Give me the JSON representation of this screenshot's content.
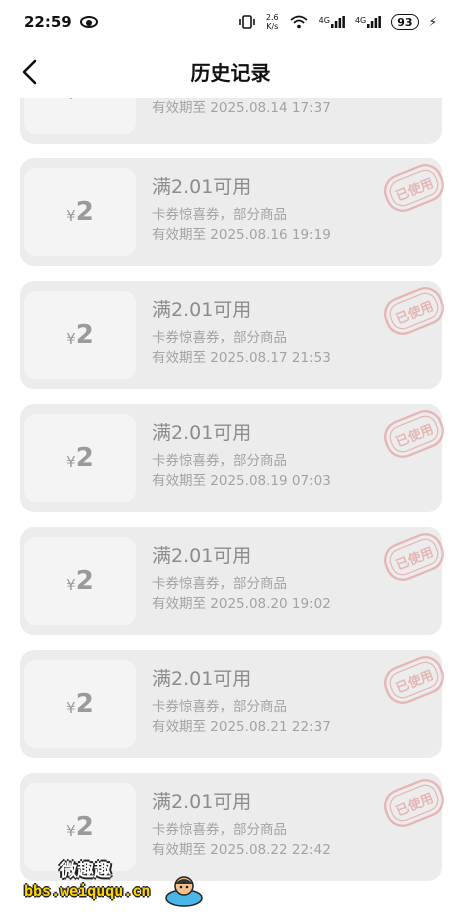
{
  "status_bar": {
    "time": "22:59",
    "net_speed_top": "2.6",
    "net_speed_unit": "K/s",
    "sig1": "4G",
    "sig2": "4G",
    "battery": "93"
  },
  "header": {
    "title": "历史记录"
  },
  "partial_card": {
    "expiry": "有效期至 2025.08.14 17:37"
  },
  "coupons": [
    {
      "currency": "¥",
      "amount": "2",
      "title": "满2.01可用",
      "desc": "卡券惊喜券，部分商品",
      "expiry": "有效期至 2025.08.16 19:19",
      "stamp": "已使用"
    },
    {
      "currency": "¥",
      "amount": "2",
      "title": "满2.01可用",
      "desc": "卡券惊喜券，部分商品",
      "expiry": "有效期至 2025.08.17 21:53",
      "stamp": "已使用"
    },
    {
      "currency": "¥",
      "amount": "2",
      "title": "满2.01可用",
      "desc": "卡券惊喜券，部分商品",
      "expiry": "有效期至 2025.08.19 07:03",
      "stamp": "已使用"
    },
    {
      "currency": "¥",
      "amount": "2",
      "title": "满2.01可用",
      "desc": "卡券惊喜券，部分商品",
      "expiry": "有效期至 2025.08.20 19:02",
      "stamp": "已使用"
    },
    {
      "currency": "¥",
      "amount": "2",
      "title": "满2.01可用",
      "desc": "卡券惊喜券，部分商品",
      "expiry": "有效期至 2025.08.21 22:37",
      "stamp": "已使用"
    },
    {
      "currency": "¥",
      "amount": "2",
      "title": "满2.01可用",
      "desc": "卡券惊喜券，部分商品",
      "expiry": "有效期至 2025.08.22 22:42",
      "stamp": "已使用"
    }
  ],
  "watermark": {
    "line1": "微趣趣",
    "line2": "bbs.weiququ.cn"
  },
  "colors": {
    "card_bg": "#ececec",
    "stub_bg": "#f4f4f4",
    "stamp": "#e08a8a"
  }
}
